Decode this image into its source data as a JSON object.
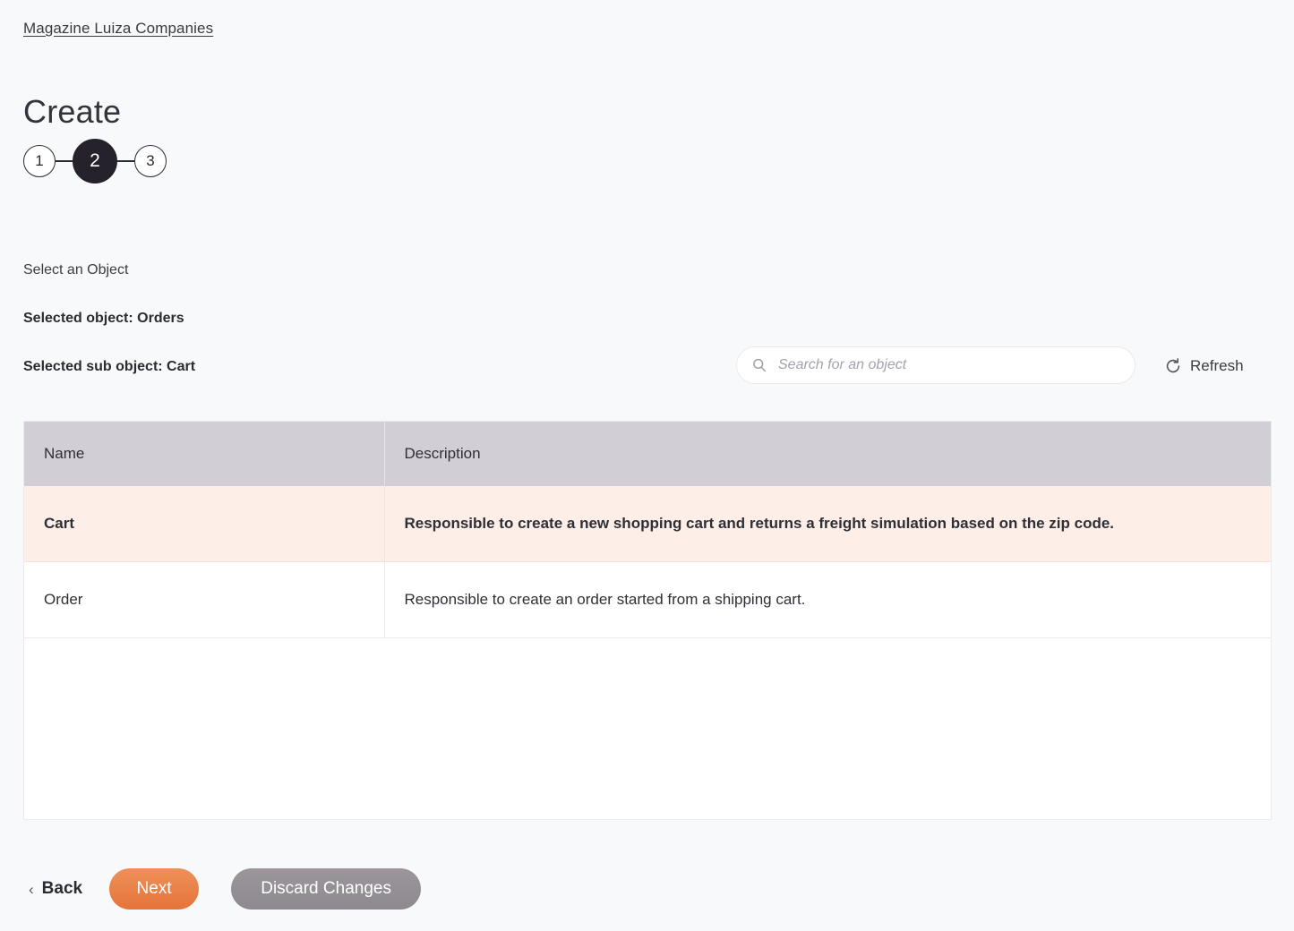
{
  "breadcrumb": {
    "label": "Magazine Luiza Companies"
  },
  "page": {
    "title": "Create"
  },
  "stepper": {
    "steps": [
      {
        "label": "1",
        "active": false
      },
      {
        "label": "2",
        "active": true
      },
      {
        "label": "3",
        "active": false
      }
    ]
  },
  "form": {
    "select_label": "Select an Object",
    "selected_object": "Selected object: Orders",
    "selected_sub_object": "Selected sub object: Cart"
  },
  "search": {
    "placeholder": "Search for an object",
    "value": "",
    "icon": "search-icon"
  },
  "refresh": {
    "label": "Refresh",
    "icon": "refresh-icon"
  },
  "table": {
    "columns": [
      "Name",
      "Description"
    ],
    "rows": [
      {
        "name": "Cart",
        "description": "Responsible to create a new shopping cart and returns a freight simulation based on the zip code.",
        "selected": true
      },
      {
        "name": "Order",
        "description": "Responsible to create an order started from a shipping cart.",
        "selected": false
      }
    ]
  },
  "footer": {
    "back_label": "Back",
    "back_chevron": "‹",
    "next_label": "Next",
    "discard_label": "Discard Changes"
  },
  "colors": {
    "background": "#f8f9fa",
    "header_row": "#d2ced6",
    "selected_row": "#fdeee7",
    "next_button": "#e8803f",
    "discard_button": "#948e94",
    "step_active": "#25222b"
  }
}
